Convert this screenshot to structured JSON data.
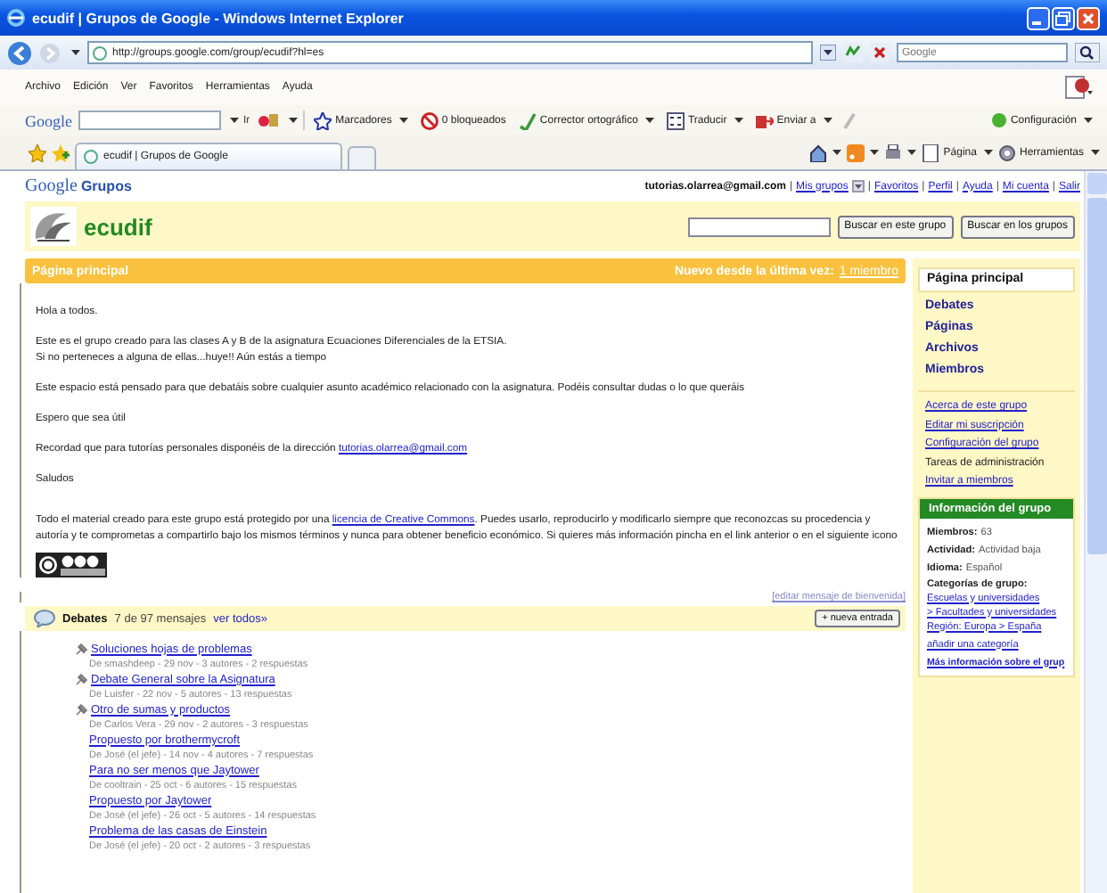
{
  "window": {
    "title": "ecudif | Grupos de Google - Windows Internet Explorer"
  },
  "address_bar": {
    "url": "http://groups.google.com/group/ecudif?hl=es",
    "search_placeholder": "Google"
  },
  "menu": [
    "Archivo",
    "Edición",
    "Ver",
    "Favoritos",
    "Herramientas",
    "Ayuda"
  ],
  "google_toolbar": {
    "logo": "Google",
    "search_button": "Ir",
    "items": [
      "Marcadores",
      "0 bloqueados",
      "Corrector ortográfico",
      "Traducir",
      "Enviar a"
    ],
    "settings": "Configuración"
  },
  "tabs": [
    {
      "label": "ecudif | Grupos de Google",
      "selected": true
    }
  ],
  "command_bar": [
    "Página",
    "Herramientas"
  ],
  "page": {
    "logo": {
      "brand": "Google",
      "product": "Grupos"
    },
    "user": {
      "email": "tutorias.olarrea@gmail.com",
      "separator": "|",
      "links": [
        "Mis grupos",
        "Favoritos",
        "Perfil",
        "Ayuda",
        "Mi cuenta",
        "Salir"
      ]
    },
    "group": {
      "name": "ecudif",
      "search_buttons": [
        "Buscar en este grupo",
        "Buscar en los grupos"
      ]
    },
    "section_bar": {
      "title": "Página principal",
      "new_label": "Nuevo desde la última vez:",
      "new_link": "1 miembro"
    },
    "welcome": [
      {
        "lines": [
          [
            {
              "text": "Hola a todos."
            }
          ]
        ]
      },
      {
        "lines": [
          [
            {
              "text": "Este es el grupo creado para las clases A y B de la asignatura Ecuaciones Diferenciales de la ETSIA."
            }
          ],
          [
            {
              "text": "Si no perteneces a alguna de ellas...huye!! Aún estás a tiempo"
            }
          ]
        ]
      },
      {
        "lines": [
          [
            {
              "text": "Este espacio está pensado para que debatáis sobre cualquier asunto académico relacionado con la asignatura. Podéis consultar dudas o lo que queráis"
            }
          ]
        ]
      },
      {
        "lines": [
          [
            {
              "text": "Espero que sea útil"
            }
          ]
        ]
      },
      {
        "lines": [
          [
            {
              "text": "Recordad que para tutorías  personales disponéis de la dirección "
            },
            {
              "text": "tutorias.olarrea@gmail.com",
              "link": true
            }
          ]
        ]
      },
      {
        "lines": [
          [
            {
              "text": "Saludos"
            }
          ]
        ]
      },
      {
        "lines": [
          [
            {
              "text": "Todo el material creado para este grupo está protegido por una "
            },
            {
              "text": "licencia de Creative Commons",
              "link": true
            },
            {
              "text": ". Puedes usarlo, reproducirlo y modificarlo siempre que reconozcas su procedencia y autoría y te comprometas a compartirlo bajo los mismos términos y nunca para obtener beneficio económico. Si quieres más información pincha en el link anterior o en el siguiente icono"
            }
          ]
        ]
      }
    ],
    "edit_link": "[editar mensaje de bienvenida]",
    "debates": {
      "title": "Debates",
      "count": "7 de 97 mensajes",
      "see_all": "ver todos»",
      "new_button": "+ nueva entrada",
      "items": [
        {
          "title": "Soluciones hojas de problemas",
          "meta": "De smashdeep - 29 nov - 3 autores - 2 respuestas",
          "pinned": true
        },
        {
          "title": "Debate General sobre la Asignatura",
          "meta": "De Luisfer - 22 nov - 5 autores - 13 respuestas",
          "pinned": true
        },
        {
          "title": "Otro de sumas y productos",
          "meta": "De Carlos Vera - 29 nov - 2 autores - 3 respuestas",
          "pinned": true
        },
        {
          "title": "Propuesto por brothermycroft",
          "meta": "De José (el jefe) - 14 nov - 4 autores - 7 respuestas",
          "pinned": false
        },
        {
          "title": "Para no ser menos que Jaytower",
          "meta": "De cooltrain - 25 oct - 6 autores - 15 respuestas",
          "pinned": false
        },
        {
          "title": "Propuesto por Jaytower",
          "meta": "De José (el jefe) - 26 oct - 5 autores - 14 respuestas",
          "pinned": false
        },
        {
          "title": "Problema de las casas de Einstein",
          "meta": "De José (el jefe) - 20 oct - 2 autores - 3 respuestas",
          "pinned": false
        }
      ]
    },
    "sidebar": {
      "nav": [
        {
          "label": "Página principal",
          "selected": true
        },
        {
          "label": "Debates",
          "selected": false
        },
        {
          "label": "Páginas",
          "selected": false
        },
        {
          "label": "Archivos",
          "selected": false
        },
        {
          "label": "Miembros",
          "selected": false
        }
      ],
      "links": [
        {
          "label": "Acerca de este grupo",
          "link": true
        },
        {
          "label": "Editar mi suscripción",
          "link": true
        },
        {
          "label": "Configuración del grupo",
          "link": true
        },
        {
          "label": "Tareas de administración",
          "link": false
        },
        {
          "label": "Invitar a miembros",
          "link": true
        }
      ],
      "info": {
        "title": "Información del grupo",
        "fields": [
          {
            "label": "Miembros:",
            "value": "63"
          },
          {
            "label": "Actividad:",
            "value": "Actividad baja"
          },
          {
            "label": "Idioma:",
            "value": "Español"
          }
        ],
        "categories_label": "Categorías de grupo:",
        "category_links": [
          "Escuelas y universidades",
          "> Facultades y universidades",
          "Región: Europa > España"
        ],
        "add_category": "añadir una categoría",
        "more": "Más información sobre el grup"
      }
    }
  }
}
